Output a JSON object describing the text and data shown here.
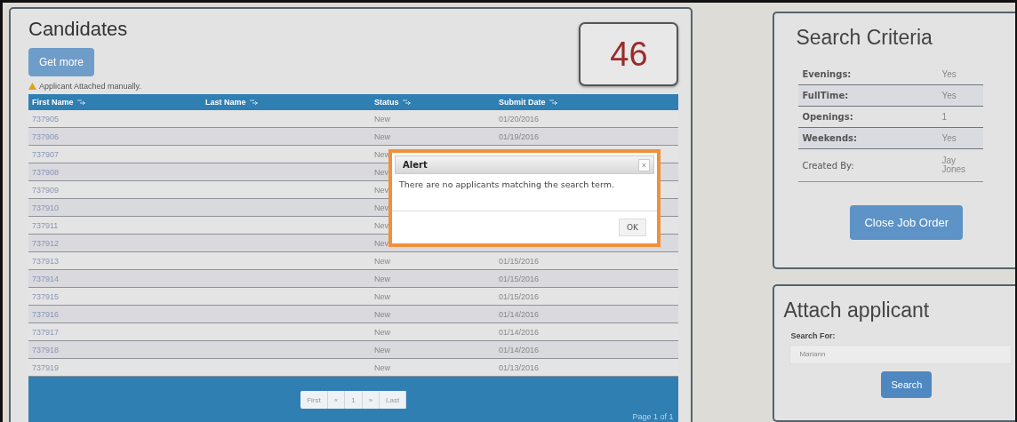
{
  "candidates": {
    "title": "Candidates",
    "get_more_button": "Get more",
    "notice": "Applicant Attached manually.",
    "count": "46",
    "columns": [
      "First Name",
      "Last Name",
      "Status",
      "Submit Date"
    ],
    "rows": [
      {
        "first_name": "737905",
        "status": "New",
        "submit_date": "01/20/2016"
      },
      {
        "first_name": "737906",
        "status": "New",
        "submit_date": "01/19/2016"
      },
      {
        "first_name": "737907",
        "status": "New"
      },
      {
        "first_name": "737908",
        "status": "Nev"
      },
      {
        "first_name": "737909",
        "status": "Nev"
      },
      {
        "first_name": "737910",
        "status": "Nev"
      },
      {
        "first_name": "737911",
        "status": "Nev"
      },
      {
        "first_name": "737912",
        "status": "Nev"
      },
      {
        "first_name": "737913",
        "status": "New",
        "submit_date": "01/15/2016"
      },
      {
        "first_name": "737914",
        "status": "New",
        "submit_date": "01/15/2016"
      },
      {
        "first_name": "737915",
        "status": "New",
        "submit_date": "01/15/2016"
      },
      {
        "first_name": "737916",
        "status": "New",
        "submit_date": "01/14/2016"
      },
      {
        "first_name": "737917",
        "status": "New",
        "submit_date": "01/14/2016"
      },
      {
        "first_name": "737918",
        "status": "New",
        "submit_date": "01/14/2016"
      },
      {
        "first_name": "737919",
        "status": "New",
        "submit_date": "01/13/2016"
      }
    ],
    "pagination": [
      "First",
      "«",
      "1",
      "»",
      "Last"
    ],
    "page_info": "Page 1 of 1"
  },
  "alert": {
    "title": "Alert",
    "close": "×",
    "message": "There are no applicants matching the search term.",
    "ok_button": "OK"
  },
  "search_criteria": {
    "title": "Search Criteria",
    "rows": [
      {
        "label": "Evenings:",
        "value": "Yes",
        "bold": true
      },
      {
        "label": "FullTime:",
        "value": "Yes",
        "bold": true
      },
      {
        "label": "Openings:",
        "value": "1",
        "bold": true
      },
      {
        "label": "Weekends:",
        "value": "Yes",
        "bold": true
      },
      {
        "label": "Created By:",
        "value": "Jay Jones",
        "bold": false
      }
    ],
    "close_button": "Close Job Order"
  },
  "attach_applicant": {
    "title": "Attach applicant",
    "search_label": "Search For:",
    "search_value": "Mariann",
    "search_button": "Search"
  }
}
